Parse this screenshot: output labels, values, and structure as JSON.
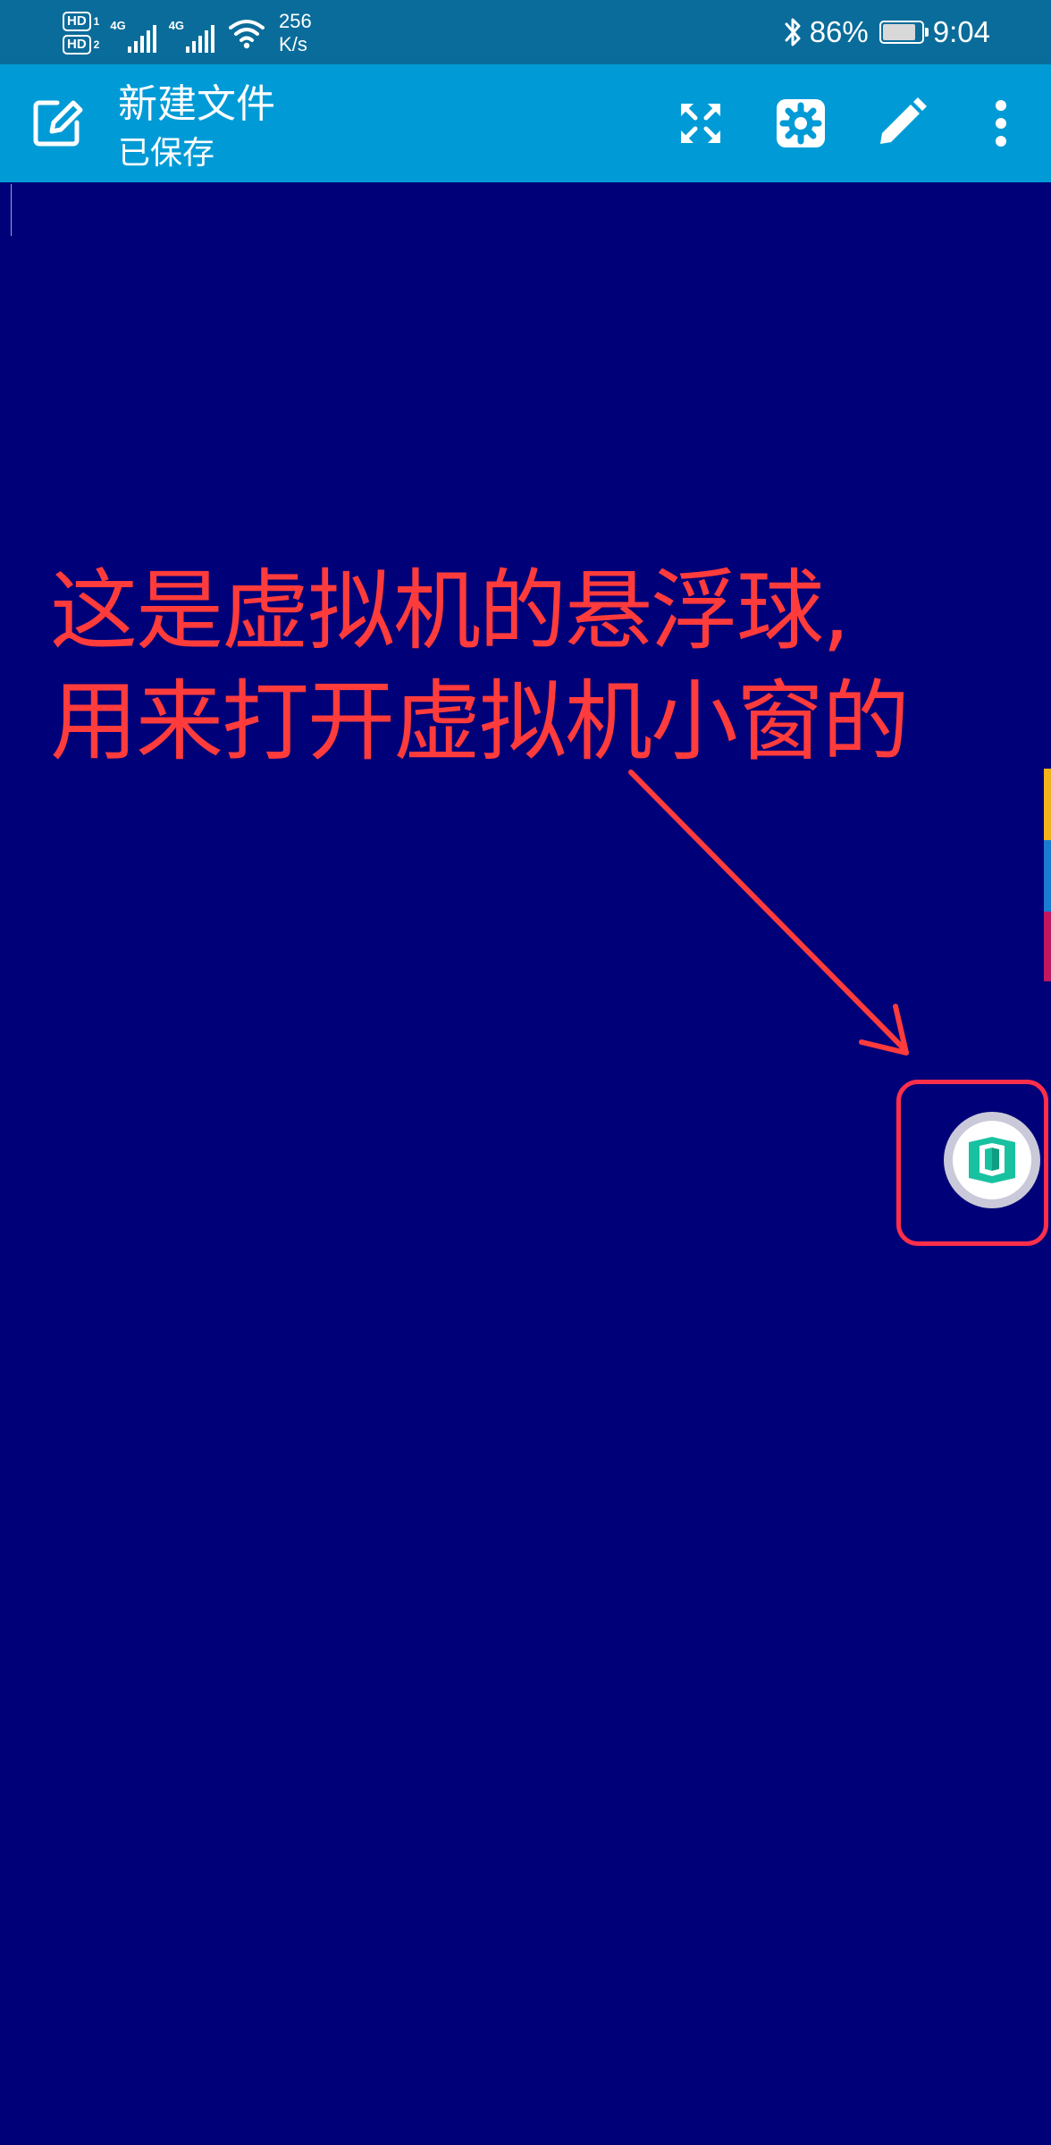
{
  "status_bar": {
    "hd1": "HD",
    "hd1_sim": "1",
    "hd2": "HD",
    "hd2_sim": "2",
    "signal1_type": "4G",
    "signal2_type": "4G",
    "speed_value": "256",
    "speed_unit": "K/s",
    "battery": "86%",
    "battery_level": 0.86,
    "time": "9:04"
  },
  "app_bar": {
    "title": "新建文件",
    "subtitle": "已保存",
    "actions": [
      "fullscreen-icon",
      "settings-icon",
      "edit-pencil-icon",
      "more-vert-icon"
    ]
  },
  "annotation": {
    "line1": "这是虚拟机的悬浮球,",
    "line2": "用来打开虚拟机小窗的"
  },
  "colors": {
    "status_bar_bg": "#0a6c9a",
    "app_bar_bg": "#009bd6",
    "editor_bg": "#000078",
    "annotation": "#ff3b3b",
    "highlight": "#ff2f4a",
    "strip_yellow": "#f2b21b",
    "strip_blue": "#1a7bd2",
    "strip_magenta": "#c0175e",
    "float_ball_teal": "#18c2a0"
  }
}
